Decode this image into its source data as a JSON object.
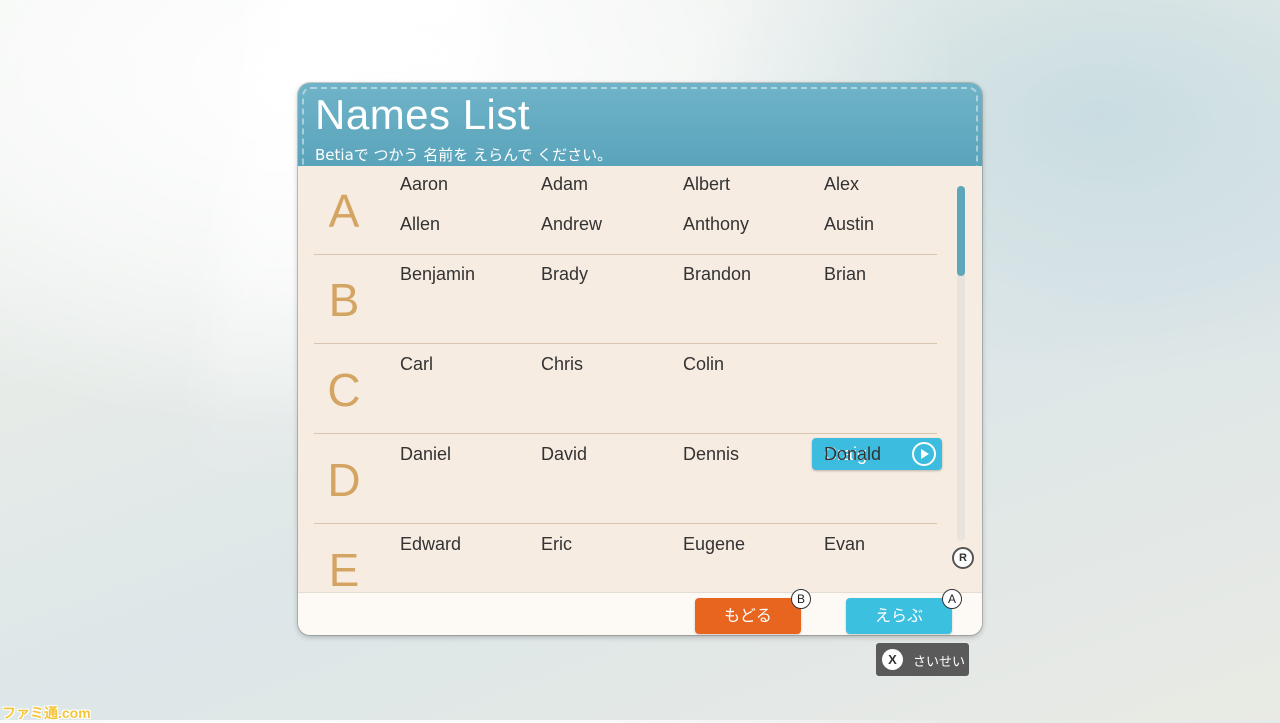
{
  "header": {
    "title": "Names List",
    "subtitle": "Betiaで つかう 名前を えらんで ください。"
  },
  "sections": [
    {
      "letter": "A",
      "names": [
        "Aaron",
        "Adam",
        "Albert",
        "Alex",
        "Allen",
        "Andrew",
        "Anthony",
        "Austin"
      ]
    },
    {
      "letter": "B",
      "names": [
        "Benjamin",
        "Brady",
        "Brandon",
        "Brian"
      ]
    },
    {
      "letter": "C",
      "names": [
        "Carl",
        "Chris",
        "Colin",
        "Craig"
      ]
    },
    {
      "letter": "D",
      "names": [
        "Daniel",
        "David",
        "Dennis",
        "Donald"
      ]
    },
    {
      "letter": "E",
      "names": [
        "Edward",
        "Eric",
        "Eugene",
        "Evan"
      ]
    }
  ],
  "selected_name": "Craig",
  "scroll_hint_icon": {
    "label": "R",
    "icon": "r-stick-icon"
  },
  "footer": {
    "back_label": "もどる",
    "back_key": "B",
    "select_label": "えらぶ",
    "select_key": "A"
  },
  "reset": {
    "key": "X",
    "label": "さいせい"
  },
  "watermark": "ファミ通.com",
  "colors": {
    "header": "#5aa4bb",
    "letter": "#d4a462",
    "selected": "#3cbde0",
    "back_button": "#e8651f",
    "select_button": "#3cc0e0"
  }
}
